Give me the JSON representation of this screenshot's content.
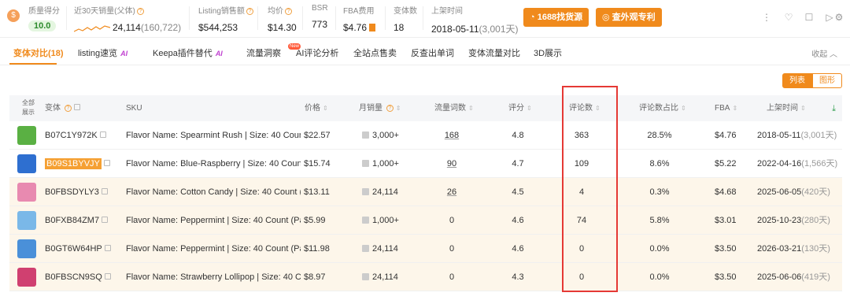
{
  "stats": {
    "score": {
      "label": "质量得分",
      "value": "10.0"
    },
    "sales30": {
      "label": "近30天销量(父体)",
      "value": "24,114",
      "sub": "(160,722)"
    },
    "listing_sales": {
      "label": "Listing销售额",
      "value": "$544,253"
    },
    "avg_price": {
      "label": "均价",
      "value": "$14.30"
    },
    "bsr": {
      "label": "BSR",
      "value": "773"
    },
    "fba": {
      "label": "FBA费用",
      "value": "$4.76"
    },
    "variants": {
      "label": "变体数",
      "value": "18"
    },
    "launch": {
      "label": "上架时间",
      "value": "2018-05-11",
      "sub": "(3,001天)"
    }
  },
  "buttons": {
    "find_source": "1688找货源",
    "patent": "查外观专利"
  },
  "tabs": [
    "变体对比(18)",
    "listing速览",
    "Keepa插件替代",
    "流量洞察",
    "AI评论分析",
    "全站点售卖",
    "反查出单词",
    "变体流量对比",
    "3D展示"
  ],
  "ai_label": "AI",
  "new_label": "New",
  "collapse": "收起",
  "view": {
    "list": "列表",
    "graph": "图形"
  },
  "columns": {
    "all": "全部展示",
    "variant": "变体",
    "sku": "SKU",
    "price": "价格",
    "monthly_sales": "月销量",
    "traffic_words": "流量词数",
    "rating": "评分",
    "reviews": "评论数",
    "review_share": "评论数占比",
    "fba": "FBA",
    "launch": "上架时间"
  },
  "rows": [
    {
      "asin": "B07C1Y972K",
      "sku": "Flavor Name: Spearmint Rush | Size: 40 Count (...",
      "price": "$22.57",
      "sales": "3,000+",
      "words": "168",
      "rating": "4.8",
      "reviews": "363",
      "share": "28.5%",
      "fba": "$4.76",
      "date": "2018-05-11",
      "days": "(3,001天)"
    },
    {
      "asin": "B09S1BYVJY",
      "sku": "Flavor Name: Blue-Raspberry | Size: 40 Count (...",
      "price": "$15.74",
      "sales": "1,000+",
      "words": "90",
      "rating": "4.7",
      "reviews": "109",
      "share": "8.6%",
      "fba": "$5.22",
      "date": "2022-04-16",
      "days": "(1,566天)"
    },
    {
      "asin": "B0FBSDYLY3",
      "sku": "Flavor Name: Cotton Candy | Size: 40 Count (P...",
      "price": "$13.11",
      "sales": "24,114",
      "words": "26",
      "rating": "4.5",
      "reviews": "4",
      "share": "0.3%",
      "fba": "$4.68",
      "date": "2025-06-05",
      "days": "(420天)"
    },
    {
      "asin": "B0FXB84ZM7",
      "sku": "Flavor Name: Peppermint | Size: 40 Count (Pac...",
      "price": "$5.99",
      "sales": "1,000+",
      "words": "0",
      "rating": "4.6",
      "reviews": "74",
      "share": "5.8%",
      "fba": "$3.01",
      "date": "2025-10-23",
      "days": "(280天)"
    },
    {
      "asin": "B0GT6W64HP",
      "sku": "Flavor Name: Peppermint | Size: 40 Count (Pac...",
      "price": "$11.98",
      "sales": "24,114",
      "words": "0",
      "rating": "4.6",
      "reviews": "0",
      "share": "0.0%",
      "fba": "$3.50",
      "date": "2026-03-21",
      "days": "(130天)"
    },
    {
      "asin": "B0FBSCN9SQ",
      "sku": "Flavor Name: Strawberry Lollipop | Size: 40 Co...",
      "price": "$8.97",
      "sales": "24,114",
      "words": "0",
      "rating": "4.3",
      "reviews": "0",
      "share": "0.0%",
      "fba": "$3.50",
      "date": "2025-06-06",
      "days": "(419天)"
    }
  ],
  "colors": {
    "accent": "#f08a1c",
    "highlight_box": "#e53935",
    "score_green": "#2b8a2b"
  }
}
